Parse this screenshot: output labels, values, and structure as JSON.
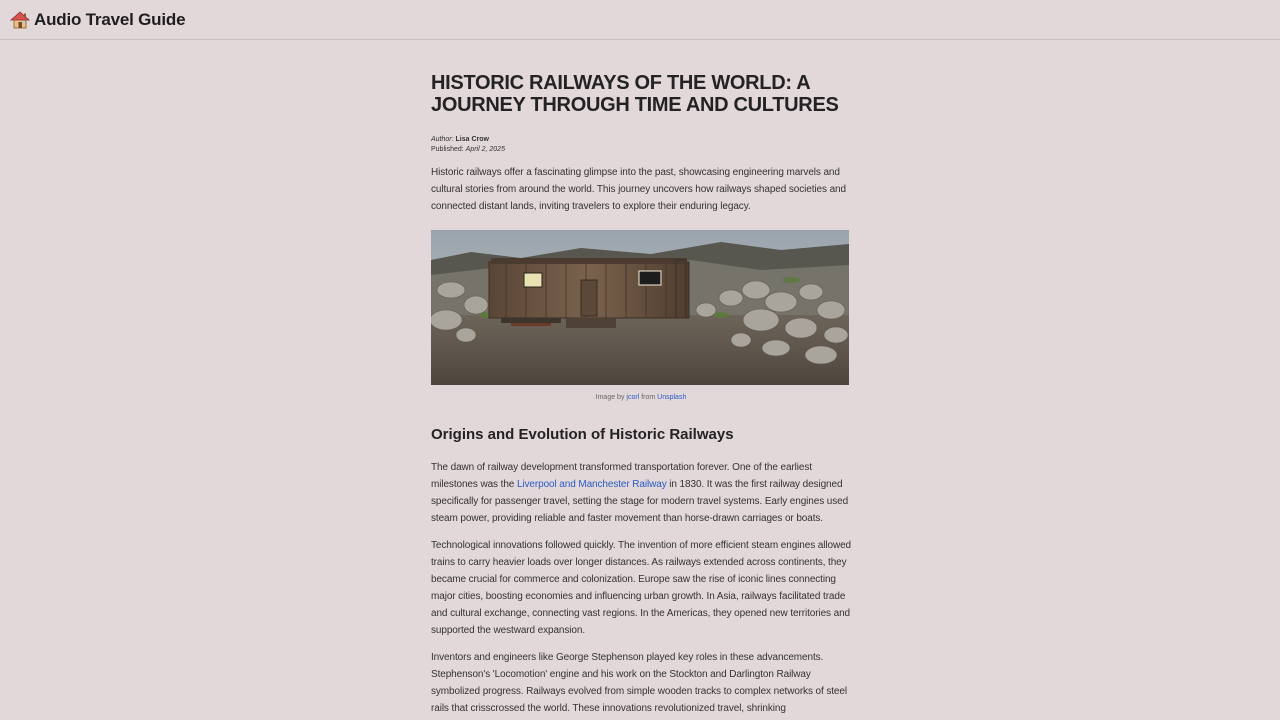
{
  "header": {
    "brand_icon": "house-icon",
    "brand_title": "Audio Travel Guide"
  },
  "article": {
    "title": "HISTORIC RAILWAYS OF THE WORLD: A JOURNEY THROUGH TIME AND CULTURES",
    "author_label": "Author:",
    "author_name": "Lisa Crow",
    "published_label": "Published:",
    "published_date": "April 2, 2025",
    "intro": "Historic railways offer a fascinating glimpse into the past, showcasing engineering marvels and cultural stories from around the world. This journey uncovers how railways shaped societies and connected distant lands, inviting travelers to explore their enduring legacy.",
    "image_caption": {
      "prefix": "Image by",
      "author_link": "jcorl",
      "middle": "from",
      "source_link": "Unsplash"
    },
    "section_heading": "Origins and Evolution of Historic Railways",
    "para1_before": "The dawn of railway development transformed transportation forever. One of the earliest milestones was the",
    "para1_link": "Liverpool and Manchester Railway",
    "para1_after": "in 1830. It was the first railway designed specifically for passenger travel, setting the stage for modern travel systems. Early engines used steam power, providing reliable and faster movement than horse-drawn carriages or boats.",
    "para2": "Technological innovations followed quickly. The invention of more efficient steam engines allowed trains to carry heavier loads over longer distances. As railways extended across continents, they became crucial for commerce and colonization. Europe saw the rise of iconic lines connecting major cities, boosting economies and influencing urban growth. In Asia, railways facilitated trade and cultural exchange, connecting vast regions. In the Americas, they opened new territories and supported the westward expansion.",
    "para3": "Inventors and engineers like George Stephenson played key roles in these advancements. Stephenson's 'Locomotion' engine and his work on the Stockton and Darlington Railway symbolized progress. Railways evolved from simple wooden tracks to complex networks of steel rails that crisscrossed the world. These innovations revolutionized travel, shrinking"
  },
  "colors": {
    "background": "#e2d8d9",
    "link": "#2a5bc7",
    "text": "#2b2b2b"
  }
}
